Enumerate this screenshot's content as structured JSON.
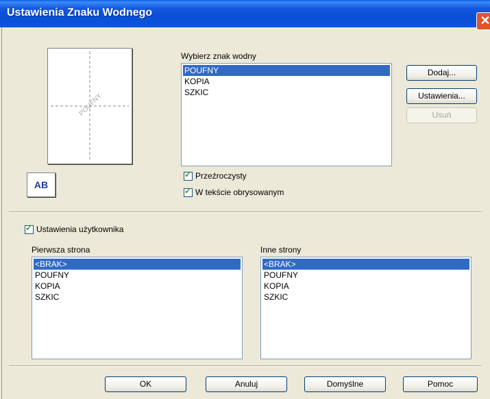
{
  "window": {
    "title": "Ustawienia Znaku Wodnego",
    "close_glyph": "✕"
  },
  "preview": {
    "watermark_text": "POUFNY",
    "icon_text": "AB"
  },
  "watermark_list": {
    "label": "Wybierz znak wodny",
    "items": [
      "POUFNY",
      "KOPIA",
      "SZKIC"
    ],
    "selected_index": 0
  },
  "buttons": {
    "add": "Dodaj...",
    "settings": "Ustawienia...",
    "delete": "Usuń"
  },
  "checkboxes": {
    "transparent": {
      "label": "Przeźroczysty",
      "checked": true
    },
    "outline": {
      "label": "W tekście obrysowanym",
      "checked": true
    },
    "custom": {
      "label": "Ustawienia użytkownika",
      "checked": true
    }
  },
  "first_page": {
    "label": "Pierwsza strona",
    "items": [
      "<BRAK>",
      "POUFNY",
      "KOPIA",
      "SZKIC"
    ],
    "selected_index": 0
  },
  "other_pages": {
    "label": "Inne strony",
    "items": [
      "<BRAK>",
      "POUFNY",
      "KOPIA",
      "SZKIC"
    ],
    "selected_index": 0
  },
  "footer": {
    "ok": "OK",
    "cancel": "Anuluj",
    "default": "Domyślne",
    "help": "Pomoc"
  },
  "colors": {
    "selection": "#316ac5",
    "titlebar": "#0a4fd6",
    "close": "#e2522b",
    "check": "#21a121"
  }
}
